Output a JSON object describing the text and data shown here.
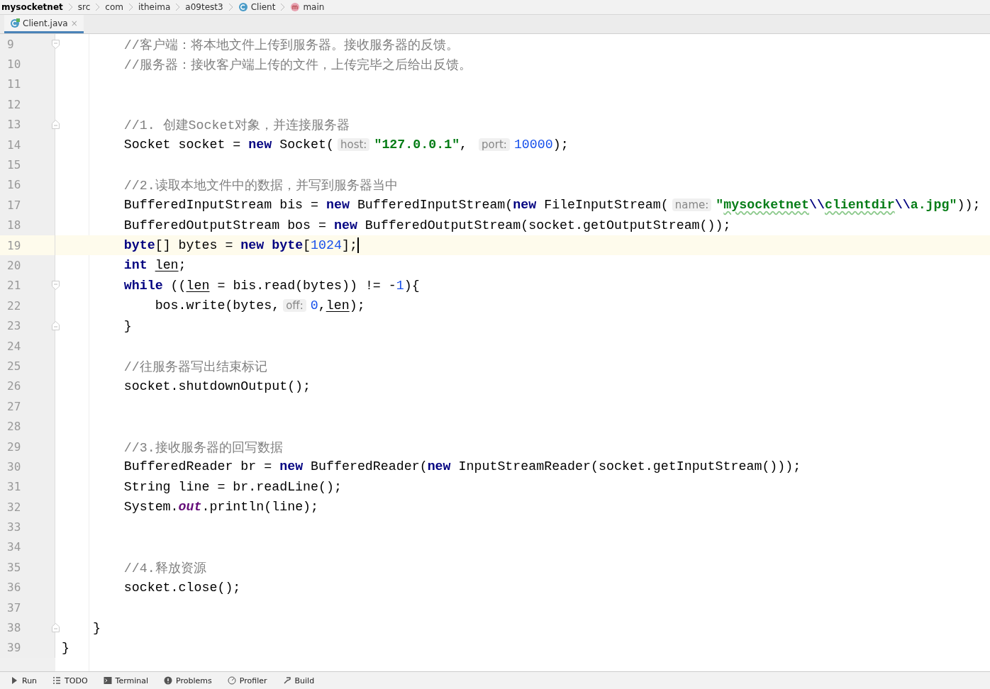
{
  "breadcrumb": [
    {
      "label": "mysocketnet",
      "kind": "project"
    },
    {
      "label": "src",
      "kind": "folder"
    },
    {
      "label": "com",
      "kind": "folder"
    },
    {
      "label": "itheima",
      "kind": "folder"
    },
    {
      "label": "a09test3",
      "kind": "folder"
    },
    {
      "label": "Client",
      "kind": "class"
    },
    {
      "label": "main",
      "kind": "method"
    }
  ],
  "tabs": [
    {
      "label": "Client.java",
      "close": "×",
      "selected": true
    }
  ],
  "editor": {
    "lines": [
      {
        "number": "9",
        "fold_start": true,
        "current": false,
        "tokens": [
          {
            "kind": "comment",
            "text": "        //客户端：将本地文件上传到服务器。接收服务器的反馈。"
          }
        ]
      },
      {
        "number": "10",
        "current": false,
        "tokens": [
          {
            "kind": "comment",
            "text": "        //服务器：接收客户端上传的文件，上传完毕之后给出反馈。"
          }
        ]
      },
      {
        "number": "11",
        "current": false
      },
      {
        "number": "12",
        "current": false
      },
      {
        "number": "13",
        "fold_end": true,
        "current": false,
        "tokens": [
          {
            "kind": "comment",
            "text": "        //1. 创建Socket对象，并连接服务器"
          }
        ]
      },
      {
        "number": "14",
        "current": false,
        "tokens": [
          {
            "kind": "plain",
            "text": "        Socket socket = "
          },
          {
            "kind": "keyword",
            "text": "new"
          },
          {
            "kind": "plain",
            "text": " Socket("
          },
          {
            "kind": "hint",
            "text": "host:"
          },
          {
            "kind": "string",
            "text": "\"127.0.0.1\""
          },
          {
            "kind": "plain",
            "text": ", "
          },
          {
            "kind": "hint",
            "text": "port:"
          },
          {
            "kind": "number",
            "text": "10000"
          },
          {
            "kind": "plain",
            "text": ");"
          }
        ]
      },
      {
        "number": "15",
        "current": false
      },
      {
        "number": "16",
        "current": false,
        "tokens": [
          {
            "kind": "comment",
            "text": "        //2.读取本地文件中的数据，并写到服务器当中"
          }
        ]
      },
      {
        "number": "17",
        "current": false,
        "tokens": [
          {
            "kind": "plain",
            "text": "        BufferedInputStream bis = "
          },
          {
            "kind": "keyword",
            "text": "new"
          },
          {
            "kind": "plain",
            "text": " BufferedInputStream("
          },
          {
            "kind": "keyword",
            "text": "new"
          },
          {
            "kind": "plain",
            "text": " FileInputStream("
          },
          {
            "kind": "hint",
            "text": "name:"
          },
          {
            "kind": "string",
            "text": "\""
          },
          {
            "kind": "typo",
            "text": "mysocketnet"
          },
          {
            "kind": "escape",
            "text": "\\\\"
          },
          {
            "kind": "typo",
            "text": "clientdir"
          },
          {
            "kind": "escape",
            "text": "\\\\"
          },
          {
            "kind": "string",
            "text": "a.jpg\""
          },
          {
            "kind": "plain",
            "text": "));"
          }
        ]
      },
      {
        "number": "18",
        "current": false,
        "tokens": [
          {
            "kind": "plain",
            "text": "        BufferedOutputStream bos = "
          },
          {
            "kind": "keyword",
            "text": "new"
          },
          {
            "kind": "plain",
            "text": " BufferedOutputStream(socket.getOutputStream());"
          }
        ]
      },
      {
        "number": "19",
        "current": true,
        "tokens": [
          {
            "kind": "keyword",
            "text": "        byte"
          },
          {
            "kind": "plain",
            "text": "[] bytes = "
          },
          {
            "kind": "keyword",
            "text": "new byte"
          },
          {
            "kind": "plain",
            "text": "["
          },
          {
            "kind": "number",
            "text": "1024"
          },
          {
            "kind": "plain",
            "text": "];"
          }
        ]
      },
      {
        "number": "20",
        "current": false,
        "tokens": [
          {
            "kind": "keyword",
            "text": "        int "
          },
          {
            "kind": "reassigned",
            "text": "len"
          },
          {
            "kind": "plain",
            "text": ";"
          }
        ]
      },
      {
        "number": "21",
        "fold_start": true,
        "current": false,
        "tokens": [
          {
            "kind": "keyword",
            "text": "        while"
          },
          {
            "kind": "plain",
            "text": " (("
          },
          {
            "kind": "reassigned",
            "text": "len"
          },
          {
            "kind": "plain",
            "text": " = bis.read(bytes)) != -"
          },
          {
            "kind": "number",
            "text": "1"
          },
          {
            "kind": "plain",
            "text": "){"
          }
        ]
      },
      {
        "number": "22",
        "current": false,
        "tokens": [
          {
            "kind": "plain",
            "text": "            bos.write(bytes,"
          },
          {
            "kind": "hint",
            "text": "off:"
          },
          {
            "kind": "number",
            "text": "0"
          },
          {
            "kind": "plain",
            "text": ","
          },
          {
            "kind": "reassigned",
            "text": "len"
          },
          {
            "kind": "plain",
            "text": ");"
          }
        ]
      },
      {
        "number": "23",
        "fold_end": true,
        "current": false,
        "tokens": [
          {
            "kind": "plain",
            "text": "        }"
          }
        ]
      },
      {
        "number": "24",
        "current": false
      },
      {
        "number": "25",
        "current": false,
        "tokens": [
          {
            "kind": "comment",
            "text": "        //往服务器写出结束标记"
          }
        ]
      },
      {
        "number": "26",
        "current": false,
        "tokens": [
          {
            "kind": "plain",
            "text": "        socket.shutdownOutput();"
          }
        ]
      },
      {
        "number": "27",
        "current": false
      },
      {
        "number": "28",
        "current": false
      },
      {
        "number": "29",
        "current": false,
        "tokens": [
          {
            "kind": "comment",
            "text": "        //3.接收服务器的回写数据"
          }
        ]
      },
      {
        "number": "30",
        "current": false,
        "tokens": [
          {
            "kind": "plain",
            "text": "        BufferedReader br = "
          },
          {
            "kind": "keyword",
            "text": "new"
          },
          {
            "kind": "plain",
            "text": " BufferedReader("
          },
          {
            "kind": "keyword",
            "text": "new"
          },
          {
            "kind": "plain",
            "text": " InputStreamReader(socket.getInputStream()));"
          }
        ]
      },
      {
        "number": "31",
        "current": false,
        "tokens": [
          {
            "kind": "plain",
            "text": "        String line = br.readLine();"
          }
        ]
      },
      {
        "number": "32",
        "current": false,
        "tokens": [
          {
            "kind": "plain",
            "text": "        System."
          },
          {
            "kind": "static",
            "text": "out"
          },
          {
            "kind": "plain",
            "text": ".println(line);"
          }
        ]
      },
      {
        "number": "33",
        "current": false
      },
      {
        "number": "34",
        "current": false
      },
      {
        "number": "35",
        "current": false,
        "tokens": [
          {
            "kind": "comment",
            "text": "        //4.释放资源"
          }
        ]
      },
      {
        "number": "36",
        "current": false,
        "tokens": [
          {
            "kind": "plain",
            "text": "        socket.close();"
          }
        ]
      },
      {
        "number": "37",
        "current": false
      },
      {
        "number": "38",
        "fold_end": true,
        "current": false,
        "tokens": [
          {
            "kind": "plain",
            "text": "    }"
          }
        ]
      },
      {
        "number": "39",
        "current": false,
        "tokens": [
          {
            "kind": "plain",
            "text": "}"
          }
        ]
      }
    ]
  },
  "tool_windows": [
    {
      "label": "Run",
      "kind": "run"
    },
    {
      "label": "TODO",
      "kind": "list"
    },
    {
      "label": "Terminal",
      "kind": "terminal"
    },
    {
      "label": "Problems",
      "kind": "problems"
    },
    {
      "label": "Profiler",
      "kind": "profiler"
    },
    {
      "label": "Build",
      "kind": "build"
    }
  ]
}
